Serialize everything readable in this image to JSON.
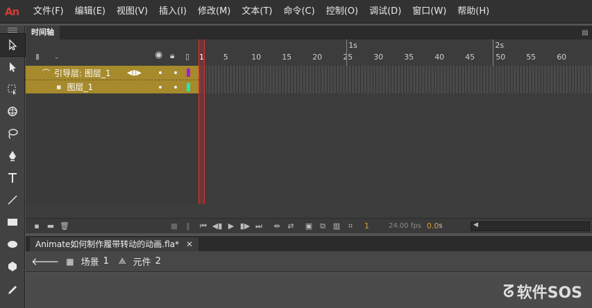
{
  "app": {
    "logo": "An"
  },
  "menu": [
    "文件(F)",
    "编辑(E)",
    "视图(V)",
    "插入(I)",
    "修改(M)",
    "文本(T)",
    "命令(C)",
    "控制(O)",
    "调试(D)",
    "窗口(W)",
    "帮助(H)"
  ],
  "timeline": {
    "tab_label": "时间轴",
    "second_markers": [
      "1s",
      "2s"
    ],
    "frame_ticks": [
      "1",
      "5",
      "10",
      "15",
      "20",
      "25",
      "30",
      "35",
      "40",
      "45",
      "50",
      "55",
      "60"
    ],
    "current_frame": "1",
    "layers": [
      {
        "name": "引导层: 图层_1",
        "type": "guide",
        "color": "#a020d0"
      },
      {
        "name": "图层_1",
        "type": "normal",
        "color": "#1ee6b8"
      }
    ],
    "status": {
      "frame": "1",
      "fps": "24.00 fps",
      "time": "0.0",
      "time_unit": "s"
    }
  },
  "document": {
    "tab_label": "Animate如何制作履带转动的动画.fla*"
  },
  "breadcrumb": {
    "scene_label": "场景",
    "scene_num": "1",
    "symbol_label": "元件",
    "symbol_num": "2"
  },
  "watermark": {
    "text": "软件SOS"
  }
}
